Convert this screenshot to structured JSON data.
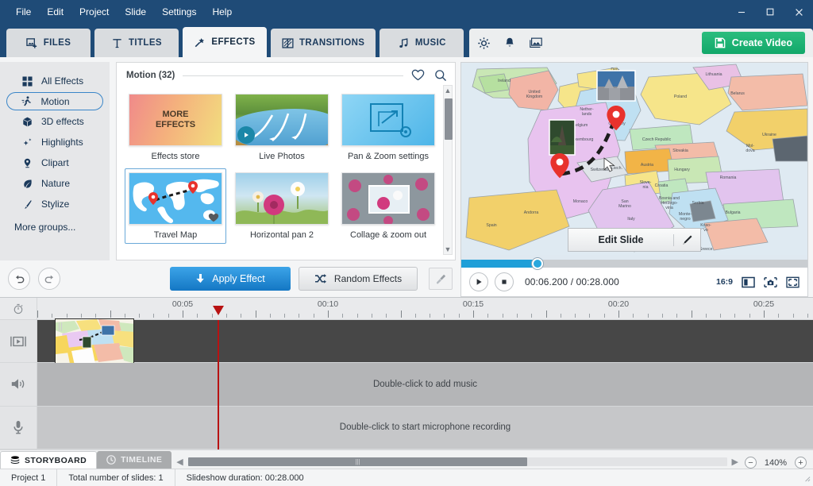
{
  "window": {
    "menu": [
      "File",
      "Edit",
      "Project",
      "Slide",
      "Settings",
      "Help"
    ],
    "controls": {
      "minimize": "—",
      "maximize": "☐",
      "close": "✕"
    }
  },
  "tabs": [
    {
      "label": "FILES",
      "icon": "add-image-icon",
      "active": false
    },
    {
      "label": "TITLES",
      "icon": "text-t-icon",
      "active": false
    },
    {
      "label": "EFFECTS",
      "icon": "magic-wand-icon",
      "active": true
    },
    {
      "label": "TRANSITIONS",
      "icon": "transition-icon",
      "active": false
    },
    {
      "label": "MUSIC",
      "icon": "music-note-icon",
      "active": false
    }
  ],
  "toolbar": {
    "icons": [
      "gear-icon",
      "bell-icon",
      "gallery-icon"
    ],
    "create_video_label": "Create Video",
    "accent_green": "#12a86a",
    "titlebar_blue": "#1f4b77"
  },
  "categories": {
    "items": [
      {
        "label": "All Effects",
        "icon": "grid-icon",
        "active": false
      },
      {
        "label": "Motion",
        "icon": "runner-icon",
        "active": true
      },
      {
        "label": "3D effects",
        "icon": "cube-icon",
        "active": false
      },
      {
        "label": "Highlights",
        "icon": "sparkle-icon",
        "active": false
      },
      {
        "label": "Clipart",
        "icon": "pin-icon",
        "active": false
      },
      {
        "label": "Nature",
        "icon": "leaf-icon",
        "active": false
      },
      {
        "label": "Stylize",
        "icon": "brush-icon",
        "active": false
      }
    ],
    "more_label": "More groups..."
  },
  "effects_panel": {
    "title": "Motion (32)",
    "favorites_icon": "heart-icon",
    "search_icon": "search-icon",
    "items": [
      {
        "label": "Effects store",
        "thumb": "more-effects",
        "thumb_text": "MORE\nEFFECTS",
        "selected": false,
        "has_play": false,
        "favorited": false
      },
      {
        "label": "Live Photos",
        "thumb": "river",
        "selected": false,
        "has_play": true,
        "favorited": false
      },
      {
        "label": "Pan & Zoom settings",
        "thumb": "pan-zoom",
        "selected": false,
        "has_play": false,
        "favorited": false
      },
      {
        "label": "Travel Map",
        "thumb": "world-map",
        "selected": true,
        "has_play": false,
        "favorited": true
      },
      {
        "label": "Horizontal pan 2",
        "thumb": "flower",
        "selected": false,
        "has_play": false,
        "favorited": false
      },
      {
        "label": "Collage & zoom out",
        "thumb": "collage",
        "selected": false,
        "has_play": false,
        "favorited": false
      }
    ],
    "more_text_line1": "MORE",
    "more_text_line2": "EFFECTS"
  },
  "actions": {
    "undo_icon": "undo-icon",
    "redo_icon": "redo-icon",
    "apply_label": "Apply Effect",
    "random_label": "Random Effects",
    "clean_icon": "broom-icon"
  },
  "preview": {
    "edit_slide_label": "Edit Slide",
    "pencil_icon": "pencil-icon",
    "seek_percent": 22,
    "current_time": "00:06.200",
    "total_time": "00:28.000",
    "timecode": "00:06.200 / 00:28.000",
    "aspect_ratio": "16:9",
    "play_icon": "play-icon",
    "stop_icon": "stop-icon",
    "right_icons": [
      "split-view-icon",
      "snapshot-icon",
      "fullscreen-icon"
    ],
    "map_labels": [
      "Ireland",
      "United Kingdom",
      "Nether-lands",
      "Belgium",
      "Luxembourg",
      "Den-mark",
      "Germany",
      "Poland",
      "Lithuania",
      "Belarus",
      "Ukraine",
      "Czech Republic",
      "Slovakia",
      "Austria",
      "Hungary",
      "Romania",
      "Switzerland",
      "Liech.",
      "Slove-nia",
      "Croatia",
      "Bosnia and Herzego-vina",
      "Serbia",
      "Monte-negro",
      "Koso-vo",
      "Bulgaria",
      "Greece",
      "Italy",
      "San Marino",
      "Monaco",
      "Andorra",
      "Spain",
      "Mol-dova"
    ]
  },
  "timeline": {
    "ruler_labels": [
      "00:05",
      "00:10",
      "00:15",
      "00:20",
      "00:25"
    ],
    "clock_icon": "stopwatch-icon",
    "tracks": [
      {
        "name": "video",
        "icon": "video-clip-icon",
        "hint": ""
      },
      {
        "name": "audio",
        "icon": "speaker-icon",
        "hint": "Double-click to add music"
      },
      {
        "name": "mic",
        "icon": "microphone-icon",
        "hint": "Double-click to start microphone recording"
      }
    ],
    "playhead_time": "00:06.200",
    "playhead_color": "#b81212"
  },
  "view_tabs": [
    {
      "label": "STORYBOARD",
      "icon": "storyboard-icon",
      "active": true
    },
    {
      "label": "TIMELINE",
      "icon": "timeline-icon",
      "active": false
    }
  ],
  "zoom_control": {
    "level": "140%",
    "minus": "−",
    "plus": "+",
    "play_arrow_icon": "play-small-icon"
  },
  "status": {
    "project": "Project 1",
    "slides": "Total number of slides: 1",
    "duration": "Slideshow duration: 00:28.000"
  }
}
